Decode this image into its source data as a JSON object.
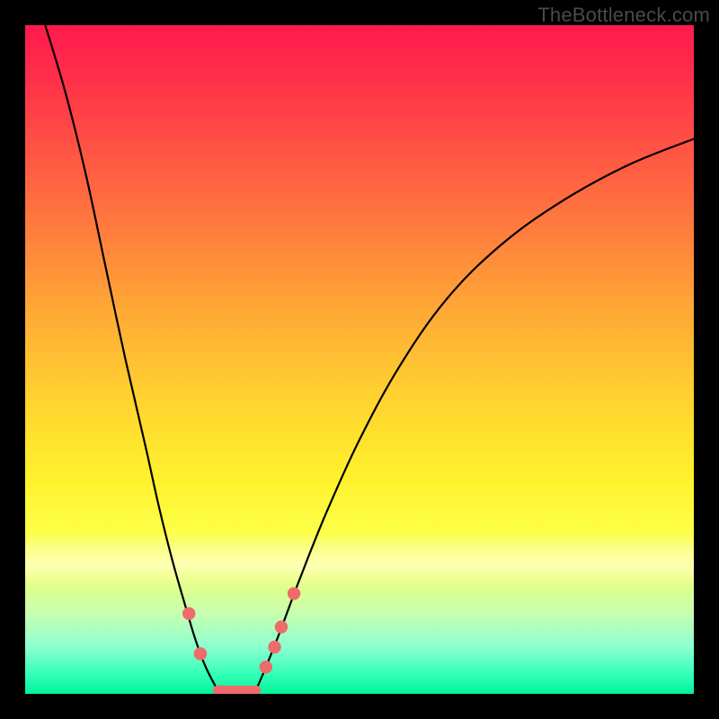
{
  "watermark": "TheBottleneck.com",
  "chart_data": {
    "type": "line",
    "title": "",
    "xlabel": "",
    "ylabel": "",
    "xlim": [
      0,
      100
    ],
    "ylim": [
      0,
      100
    ],
    "grid": false,
    "legend": false,
    "series": [
      {
        "name": "left-curve",
        "x": [
          3,
          6,
          9,
          12,
          15,
          18,
          20,
          22,
          24,
          25.5,
          27,
          28.8
        ],
        "y": [
          100,
          90,
          78,
          64,
          50,
          37,
          28,
          20,
          13,
          8,
          4,
          0.5
        ]
      },
      {
        "name": "right-curve",
        "x": [
          34.5,
          36,
          38,
          41,
          45,
          50,
          56,
          63,
          71,
          80,
          90,
          100
        ],
        "y": [
          0.5,
          4,
          9,
          17,
          27,
          38,
          49,
          59,
          67,
          73.5,
          79,
          83
        ]
      }
    ],
    "valley": {
      "name": "optimal-segment",
      "x": [
        28.8,
        34.5
      ],
      "y": [
        0.5,
        0.5
      ]
    },
    "markers": [
      {
        "name": "left-marker-upper",
        "x": 24.5,
        "y": 12
      },
      {
        "name": "left-marker-lower",
        "x": 26.2,
        "y": 6
      },
      {
        "name": "right-marker-1",
        "x": 36.0,
        "y": 4
      },
      {
        "name": "right-marker-2",
        "x": 37.3,
        "y": 7
      },
      {
        "name": "right-marker-3",
        "x": 38.3,
        "y": 10
      },
      {
        "name": "right-marker-4",
        "x": 40.2,
        "y": 15
      }
    ],
    "gradient_stops": [
      {
        "pos": 0,
        "color": "#ff1a4d"
      },
      {
        "pos": 30,
        "color": "#ff7a3e"
      },
      {
        "pos": 55,
        "color": "#ffd030"
      },
      {
        "pos": 76,
        "color": "#fdff4a"
      },
      {
        "pos": 93,
        "color": "#8cffd0"
      },
      {
        "pos": 100,
        "color": "#00f39a"
      }
    ]
  }
}
